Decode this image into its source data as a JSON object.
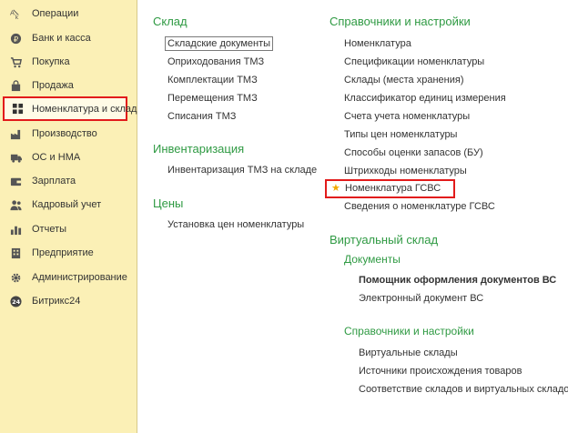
{
  "sidebar": {
    "items": [
      {
        "label": "Операции",
        "icon": "operations-icon"
      },
      {
        "label": "Банк и касса",
        "icon": "bank-cash-icon"
      },
      {
        "label": "Покупка",
        "icon": "cart-icon"
      },
      {
        "label": "Продажа",
        "icon": "sales-bag-icon"
      },
      {
        "label": "Номенклатура и склад",
        "icon": "warehouse-grid-icon"
      },
      {
        "label": "Производство",
        "icon": "factory-icon"
      },
      {
        "label": "ОС и НМА",
        "icon": "truck-icon"
      },
      {
        "label": "Зарплата",
        "icon": "salary-wallet-icon"
      },
      {
        "label": "Кадровый учет",
        "icon": "people-icon"
      },
      {
        "label": "Отчеты",
        "icon": "reports-chart-icon"
      },
      {
        "label": "Предприятие",
        "icon": "building-icon"
      },
      {
        "label": "Администрирование",
        "icon": "gear-icon"
      },
      {
        "label": "Битрикс24",
        "icon": "bitrix24-icon"
      }
    ]
  },
  "left_column": {
    "sklad": {
      "title": "Склад",
      "links": [
        "Складские документы",
        "Оприходования ТМЗ",
        "Комплектации ТМЗ",
        "Перемещения ТМЗ",
        "Списания ТМЗ"
      ]
    },
    "inventory": {
      "title": "Инвентаризация",
      "links": [
        "Инвентаризация ТМЗ на складе"
      ]
    },
    "prices": {
      "title": "Цены",
      "links": [
        "Установка цен номенклатуры"
      ]
    }
  },
  "right_column": {
    "refs": {
      "title": "Справочники и настройки",
      "links": [
        "Номенклатура",
        "Спецификации номенклатуры",
        "Склады (места хранения)",
        "Классификатор единиц измерения",
        "Счета учета номенклатуры",
        "Типы цен номенклатуры",
        "Способы оценки запасов (БУ)",
        "Штрихкоды номенклатуры"
      ],
      "highlighted": {
        "label": "Номенклатура ГСВС",
        "icon": "star-icon"
      },
      "after": [
        "Сведения о номенклатуре ГСВС"
      ]
    },
    "virtual": {
      "title": "Виртуальный склад",
      "docs_title": "Документы",
      "docs_links": [
        "Помощник оформления документов ВС",
        "Электронный документ ВС"
      ],
      "refs_title": "Справочники и настройки",
      "refs_links": [
        "Виртуальные склады",
        "Источники происхождения товаров",
        "Соответствие складов и виртуальных складов"
      ]
    }
  },
  "colors": {
    "sidebar_bg": "#fbf0b6",
    "heading_green": "#2f9a43",
    "highlight_red": "#e21b1b",
    "star": "#f2a900"
  }
}
